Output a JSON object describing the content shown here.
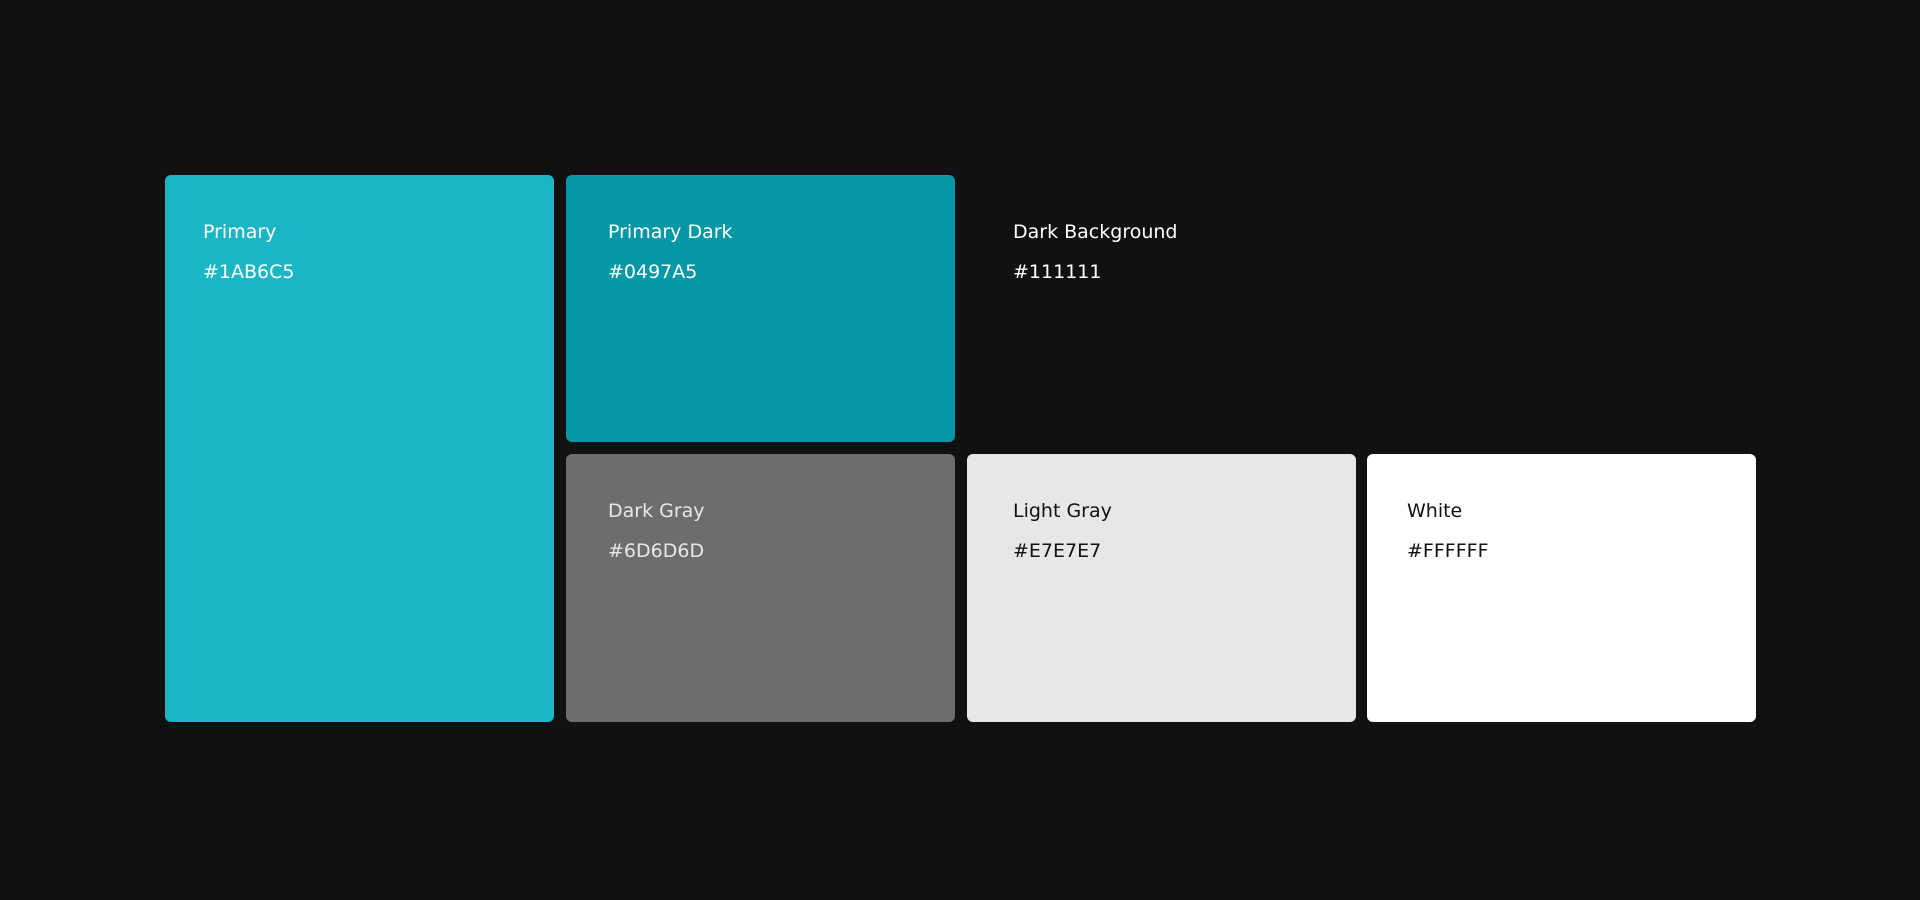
{
  "swatches": [
    {
      "name": "Primary",
      "hex": "#1AB6C5",
      "fill": "#1AB6C5",
      "text_color": "#FFFFFF"
    },
    {
      "name": "Primary Dark",
      "hex": "#0497A5",
      "fill": "#0497A5",
      "text_color": "#FFFFFF"
    },
    {
      "name": "Dark Background",
      "hex": "#111111",
      "fill": "#111111",
      "text_color": "#FFFFFF"
    },
    {
      "name": "Dark Gray",
      "hex": "#6D6D6D",
      "fill": "#6D6D6D",
      "text_color": "#E7E7E7"
    },
    {
      "name": "Light Gray",
      "hex": "#E7E7E7",
      "fill": "#E7E7E7",
      "text_color": "#111111"
    },
    {
      "name": "White",
      "hex": "#FFFFFF",
      "fill": "#FFFFFF",
      "text_color": "#111111"
    }
  ]
}
